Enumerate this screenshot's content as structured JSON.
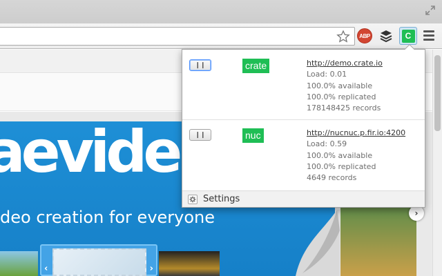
{
  "browser": {
    "icons": [
      "expand-icon",
      "bookmark-star-icon",
      "adblock-plus-icon",
      "buffer-icon",
      "crate-extension-icon",
      "chrome-menu-icon"
    ],
    "extensions": {
      "abp_label": "ABP",
      "crate_label": "C",
      "crate_color": "#1fbe55"
    }
  },
  "hero": {
    "logo_text": "aevide",
    "tagline": "deo creation for everyone",
    "colors": {
      "background": "#1e8fd6"
    }
  },
  "popup": {
    "clusters": [
      {
        "name": "crate",
        "url": "http://demo.crate.io",
        "load": "Load: 0.01",
        "available": "100.0% available",
        "replicated": "100.0% replicated",
        "records": "178148425 records",
        "pause_icon": "pause-icon"
      },
      {
        "name": "nuc",
        "url": "http://nucnuc.p.fir.io:4200",
        "load": "Load: 0.59",
        "available": "100.0% available",
        "replicated": "100.0% replicated",
        "records": "4649 records",
        "pause_icon": "pause-icon"
      }
    ],
    "footer": {
      "settings_label": "Settings",
      "settings_icon": "gear-icon"
    }
  }
}
